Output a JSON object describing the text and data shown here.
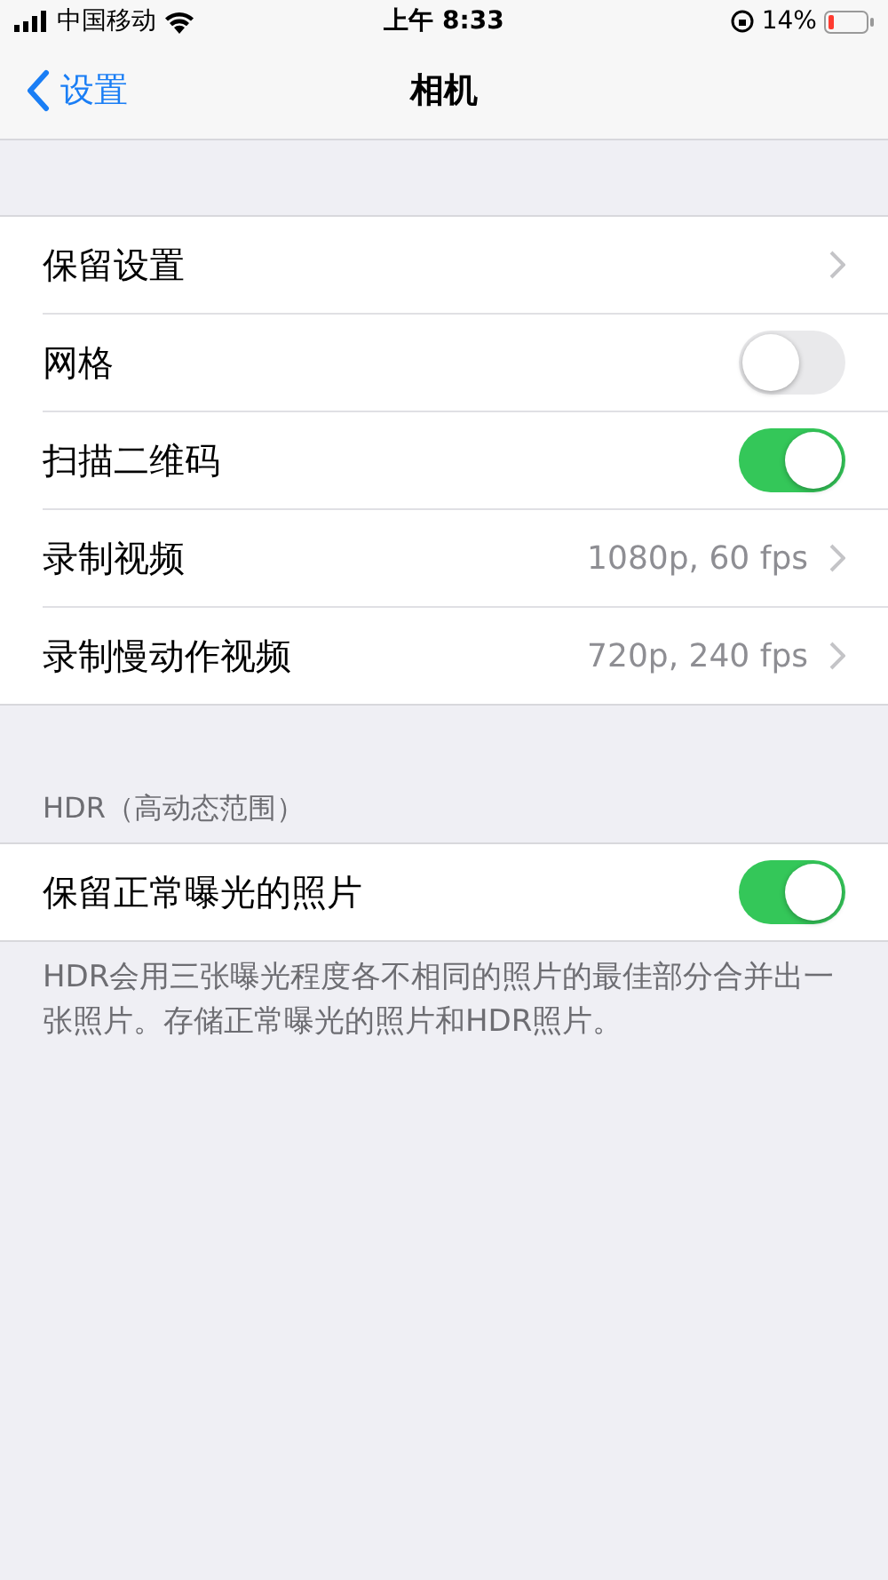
{
  "status_bar": {
    "carrier": "中国移动",
    "time": "上午 8:33",
    "battery": "14%"
  },
  "nav": {
    "back": "设置",
    "title": "相机"
  },
  "groups": [
    {
      "rows": [
        {
          "kind": "link",
          "label": "保留设置"
        },
        {
          "kind": "toggle",
          "label": "网格",
          "on": false
        },
        {
          "kind": "toggle",
          "label": "扫描二维码",
          "on": true
        },
        {
          "kind": "link",
          "label": "录制视频",
          "value": "1080p, 60 fps"
        },
        {
          "kind": "link",
          "label": "录制慢动作视频",
          "value": "720p, 240 fps"
        }
      ]
    },
    {
      "header": "HDR（高动态范围）",
      "rows": [
        {
          "kind": "toggle",
          "label": "保留正常曝光的照片",
          "on": true
        }
      ],
      "footer": "HDR会用三张曝光程度各不相同的照片的最佳部分合并出一张照片。存储正常曝光的照片和HDR照片。"
    }
  ]
}
